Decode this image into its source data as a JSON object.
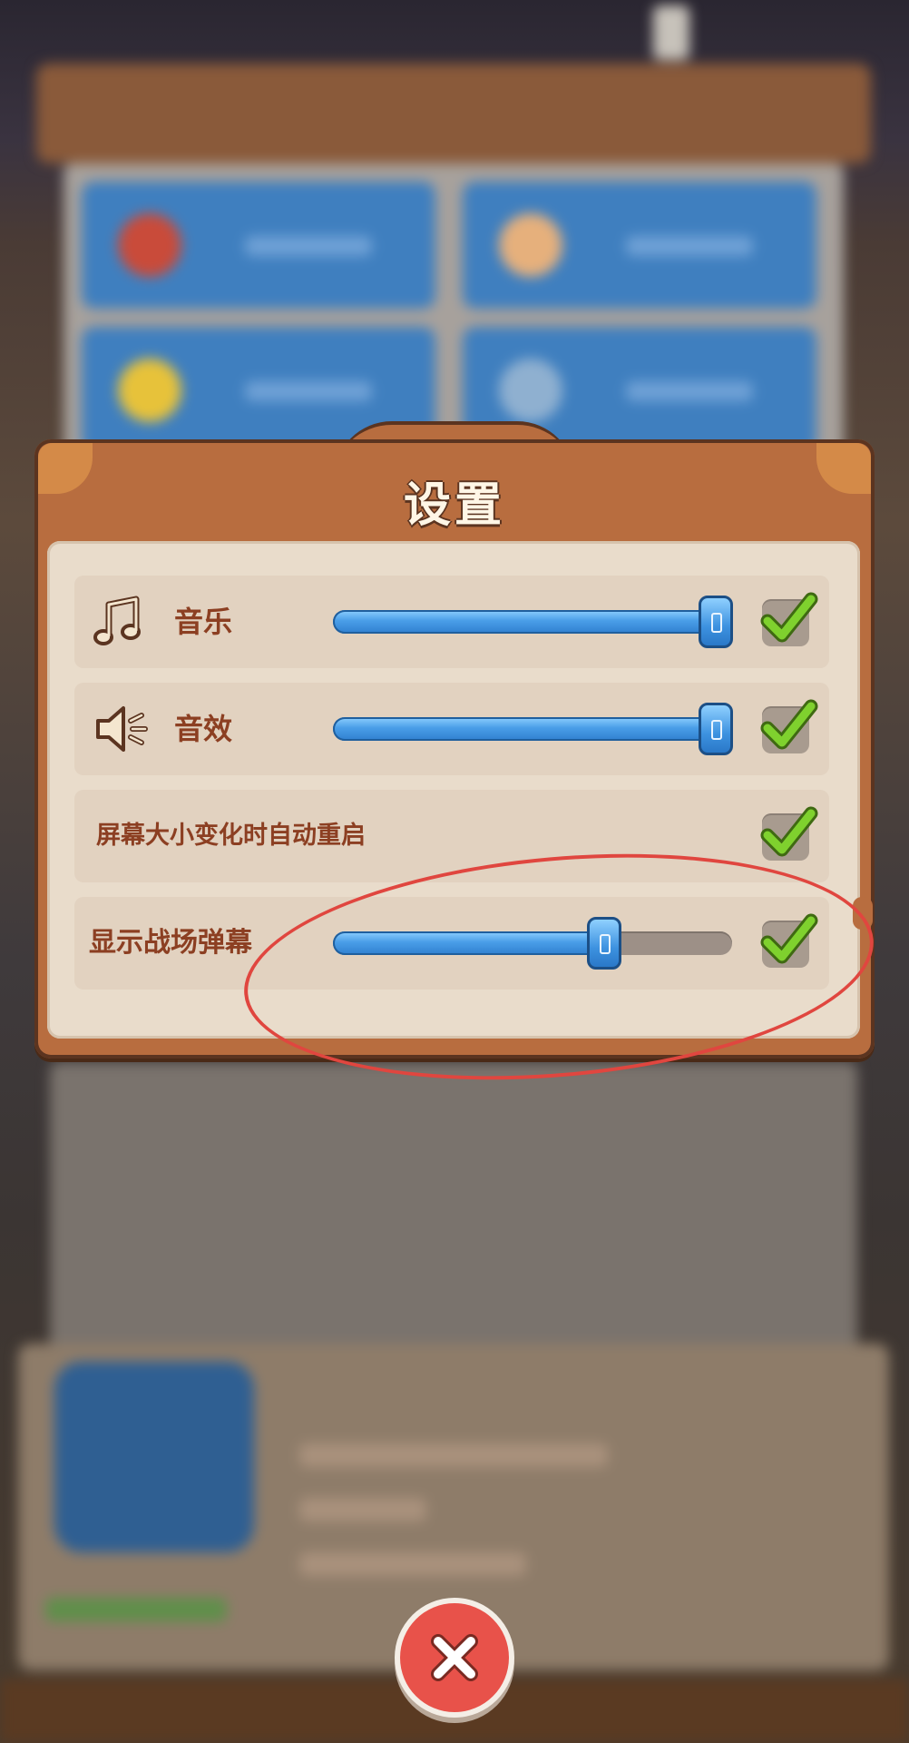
{
  "background": {
    "title": "",
    "description_hidden": true
  },
  "dialog": {
    "title": "设置",
    "rows": [
      {
        "label": "音乐",
        "icon": "music-note-icon",
        "slider_value": 0.96,
        "checked": true
      },
      {
        "label": "音效",
        "icon": "speaker-icon",
        "slider_value": 0.96,
        "checked": true
      },
      {
        "label": "屏幕大小变化时自动重启",
        "checked": true
      },
      {
        "label": "显示战场弹幕",
        "slider_value": 0.68,
        "checked": true
      }
    ]
  },
  "close_button": {
    "icon": "close-icon"
  },
  "colors": {
    "frame": "#b86d3f",
    "panel": "#e9dccb",
    "label": "#8c3f22",
    "slider_fill": "#4a9ee8",
    "check": "#7fd12e",
    "annotation": "#e0463f",
    "close": "#e8524a"
  }
}
